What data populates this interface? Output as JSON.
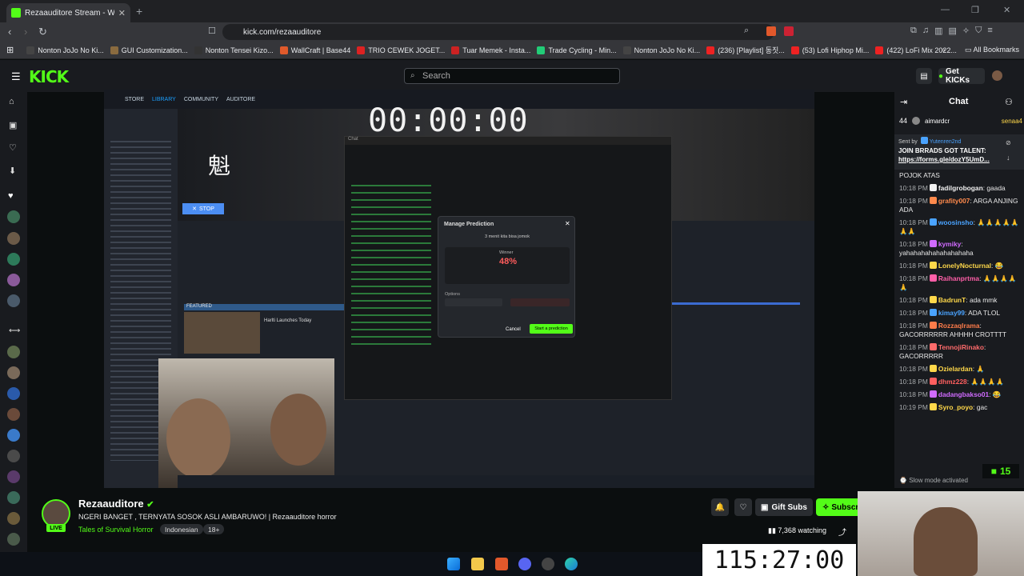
{
  "browser": {
    "tab_title": "Rezaauditore Stream - Watch",
    "url": "kick.com/rezaauditore",
    "bookmarks": [
      {
        "label": "Nonton JoJo No Ki...",
        "color": "#444"
      },
      {
        "label": "GUI Customization...",
        "color": "#8a6b3f"
      },
      {
        "label": "Nonton Tensei Kizo...",
        "color": "#333"
      },
      {
        "label": "WallCraft | Base44",
        "color": "#e05a2b"
      },
      {
        "label": "TRIO CEWEK JOGET...",
        "color": "#d22"
      },
      {
        "label": "Tuar Memek - Insta...",
        "color": "#c22"
      },
      {
        "label": "Trade Cycling - Min...",
        "color": "#2c7"
      },
      {
        "label": "Nonton JoJo No Ki...",
        "color": "#444"
      },
      {
        "label": "(236) [Playlist] 동짓...",
        "color": "#e22"
      },
      {
        "label": "(53) Lofi Hiphop Mi...",
        "color": "#e22"
      },
      {
        "label": "(422) LoFi Mix 2022...",
        "color": "#e22"
      }
    ],
    "all_bookmarks": "All Bookmarks"
  },
  "header": {
    "logo": "KICK",
    "search_placeholder": "Search",
    "get_kicks": "Get KICKs"
  },
  "stream": {
    "overlay_timer": "00:00:00",
    "steam_nav": [
      "STORE",
      "LIBRARY",
      "COMMUNITY",
      "AUDITORE"
    ],
    "stop_label": "STOP",
    "popup_title": "Chat",
    "modal": {
      "title": "Manage Prediction",
      "question": "3 menit kita bisa jomok",
      "winner_label": "Winner",
      "percent": "48%",
      "options_label": "Options",
      "cancel": "Cancel",
      "start": "Start a prediction"
    },
    "featured": "FEATURED",
    "game_release": "Harlti Launches Today"
  },
  "chat": {
    "title": "Chat",
    "top_count": "44",
    "top_user": "aimardcr",
    "top_user2": "senaa4",
    "pinned_by": "Sent by",
    "pinned_user": "Yutenren2nd",
    "pinned_text": "JOIN BRRADS GOT TALENT:",
    "pinned_link": "https://forms.gle/dozY5UmD...",
    "messages": [
      {
        "time": "",
        "user": "",
        "color": "#fff",
        "text": "POJOK ATAS"
      },
      {
        "time": "10:18 PM",
        "user": "fadilgrobogan",
        "color": "#f2f2f2",
        "text": "gaada"
      },
      {
        "time": "10:18 PM",
        "user": "grafity007",
        "color": "#ff8a4c",
        "text": "ARGA ANJING ADA"
      },
      {
        "time": "10:18 PM",
        "user": "woosinsho",
        "color": "#4aa3ff",
        "text": "🙏🙏🙏🙏🙏🙏🙏"
      },
      {
        "time": "10:18 PM",
        "user": "kymiky",
        "color": "#d06bff",
        "text": "yahahahahahahahahaha"
      },
      {
        "time": "10:18 PM",
        "user": "LonelyNocturnal",
        "color": "#ffd84a",
        "text": "😂"
      },
      {
        "time": "10:18 PM",
        "user": "Raihanprtma",
        "color": "#ff5fa8",
        "text": "🙏🙏🙏🙏🙏"
      },
      {
        "time": "10:18 PM",
        "user": "BadrunT",
        "color": "#ffd84a",
        "text": "ada mmk"
      },
      {
        "time": "10:18 PM",
        "user": "kimay99",
        "color": "#4aa3ff",
        "text": "ADA TLOL"
      },
      {
        "time": "10:18 PM",
        "user": "Rozzaqlrama",
        "color": "#ff7c4a",
        "text": "GACORRRRRR AHHHH CROTTTT"
      },
      {
        "time": "10:18 PM",
        "user": "TennojiRinako",
        "color": "#ff6b6b",
        "text": "GACORRRRR"
      },
      {
        "time": "10:18 PM",
        "user": "Ozielardan",
        "color": "#ffd84a",
        "text": "🙏"
      },
      {
        "time": "10:18 PM",
        "user": "dhmz228",
        "color": "#ff5f5f",
        "text": "🙏🙏🙏🙏"
      },
      {
        "time": "10:18 PM",
        "user": "dadangbakso01",
        "color": "#d06bff",
        "text": "😂"
      },
      {
        "time": "10:19 PM",
        "user": "Syro_poyo",
        "color": "#ffd84a",
        "text": "gac"
      }
    ],
    "slow_mode": "Slow mode activated",
    "count_badge": "15"
  },
  "channel": {
    "name": "Rezaauditore",
    "live": "LIVE",
    "title": "NGERI BANGET , TERNYATA SOSOK ASLI AMBARUWO! | Rezaauditore horror",
    "category": "Tales of Survival Horror",
    "tags": [
      "Indonesian",
      "18+"
    ],
    "gift_subs": "Gift Subs",
    "subscribe": "Subscribe",
    "watching": "7,368 watching"
  },
  "overlay": {
    "big_timer": "115:27:00"
  }
}
